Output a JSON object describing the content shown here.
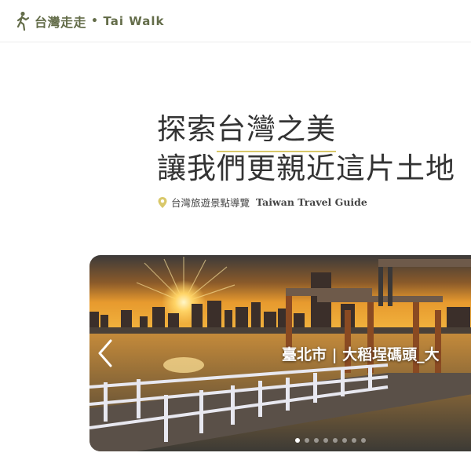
{
  "header": {
    "brand_zh": "台灣走走",
    "separator": "•",
    "brand_en": "Tai Walk",
    "logo_icon": "walking-person-icon",
    "brand_color": "#646d4a"
  },
  "hero": {
    "title_part1": "探索",
    "title_accent": "台灣之美",
    "title_line2": "讓我們更親近這片土地",
    "subtitle_zh": "台灣旅遊景點導覽",
    "subtitle_en": "Taiwan Travel Guide",
    "pin_icon": "map-pin-icon",
    "accent_color": "#d9c86a"
  },
  "carousel": {
    "caption": "臺北市 | 大稻埕碼頭_大",
    "prev_icon": "chevron-left-icon",
    "slide_count": 8,
    "active_index": 0
  }
}
